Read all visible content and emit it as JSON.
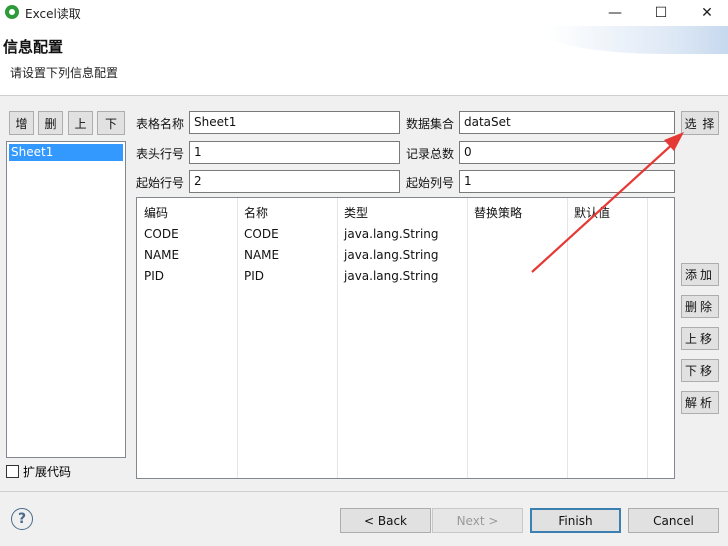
{
  "window": {
    "title": "Excel读取",
    "minimize_glyph": "—",
    "maximize_glyph": "☐",
    "close_glyph": "✕",
    "app_icon": "eclipse-app-icon"
  },
  "header": {
    "title": "信息配置",
    "description": "请设置下列信息配置"
  },
  "sheet_toolbar": {
    "add": "增",
    "delete": "删",
    "up": "上",
    "down": "下"
  },
  "sheet_list": {
    "items": [
      "Sheet1"
    ],
    "selected": "Sheet1"
  },
  "extend_code": {
    "label": "扩展代码",
    "checked": false
  },
  "form": {
    "table_name_label": "表格名称",
    "table_name_value": "Sheet1",
    "dataset_label": "数据集合",
    "dataset_value": "dataSet",
    "select_button": "选 择",
    "header_row_label": "表头行号",
    "header_row_value": "1",
    "record_count_label": "记录总数",
    "record_count_value": "0",
    "start_row_label": "起始行号",
    "start_row_value": "2",
    "start_col_label": "起始列号",
    "start_col_value": "1"
  },
  "table": {
    "columns": [
      "编码",
      "名称",
      "类型",
      "替换策略",
      "默认值"
    ],
    "rows": [
      [
        "CODE",
        "CODE",
        "java.lang.String",
        "",
        ""
      ],
      [
        "NAME",
        "NAME",
        "java.lang.String",
        "",
        ""
      ],
      [
        "PID",
        "PID",
        "java.lang.String",
        "",
        ""
      ]
    ]
  },
  "actions": {
    "add": "添加",
    "delete": "删除",
    "move_up": "上移",
    "move_down": "下移",
    "parse": "解析"
  },
  "footer": {
    "help_glyph": "?",
    "back": "< Back",
    "next": "Next >",
    "finish": "Finish",
    "cancel": "Cancel"
  },
  "colors": {
    "selection": "#3399ff",
    "annotation_arrow": "#e53935"
  }
}
